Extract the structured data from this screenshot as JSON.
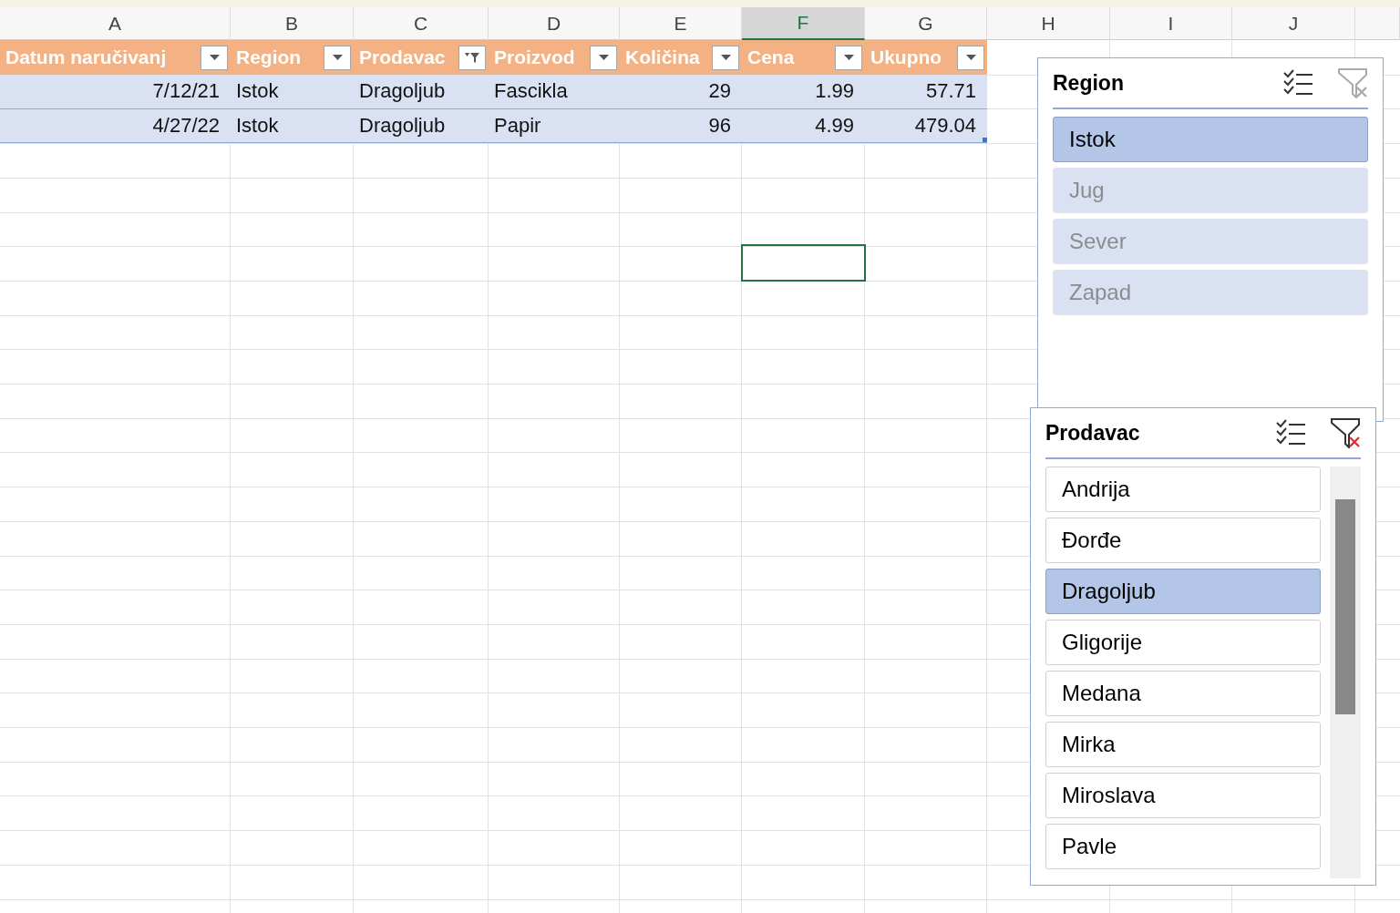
{
  "columns": [
    {
      "letter": "A",
      "selected": false
    },
    {
      "letter": "B",
      "selected": false
    },
    {
      "letter": "C",
      "selected": false
    },
    {
      "letter": "D",
      "selected": false
    },
    {
      "letter": "E",
      "selected": false
    },
    {
      "letter": "F",
      "selected": true
    },
    {
      "letter": "G",
      "selected": false
    },
    {
      "letter": "H",
      "selected": false
    },
    {
      "letter": "I",
      "selected": false
    },
    {
      "letter": "J",
      "selected": false
    }
  ],
  "table": {
    "headers": [
      {
        "label": "Datum naručivanj",
        "align_right": true,
        "filtered": false
      },
      {
        "label": "Region",
        "align_right": false,
        "filtered": false
      },
      {
        "label": "Prodavac",
        "align_right": false,
        "filtered": true
      },
      {
        "label": "Proizvod",
        "align_right": false,
        "filtered": false
      },
      {
        "label": "Količina",
        "align_right": true,
        "filtered": false
      },
      {
        "label": "Cena",
        "align_right": true,
        "filtered": false
      },
      {
        "label": "Ukupno",
        "align_right": true,
        "filtered": false
      }
    ],
    "rows": [
      [
        "7/12/21",
        "Istok",
        "Dragoljub",
        "Fascikla",
        "29",
        "1.99",
        "57.71"
      ],
      [
        "4/27/22",
        "Istok",
        "Dragoljub",
        "Papir",
        "96",
        "4.99",
        "479.04"
      ]
    ]
  },
  "slicers": [
    {
      "title": "Region",
      "clear_enabled": false,
      "scrollable": false,
      "items": [
        {
          "label": "Istok",
          "selected": true,
          "has_data": true
        },
        {
          "label": "Jug",
          "selected": false,
          "has_data": false
        },
        {
          "label": "Sever",
          "selected": false,
          "has_data": false
        },
        {
          "label": "Zapad",
          "selected": false,
          "has_data": false
        }
      ]
    },
    {
      "title": "Prodavac",
      "clear_enabled": true,
      "scrollable": true,
      "items": [
        {
          "label": "Andrija",
          "selected": false,
          "has_data": true
        },
        {
          "label": "Đorđe",
          "selected": false,
          "has_data": true
        },
        {
          "label": "Dragoljub",
          "selected": true,
          "has_data": true
        },
        {
          "label": "Gligorije",
          "selected": false,
          "has_data": true
        },
        {
          "label": "Medana",
          "selected": false,
          "has_data": true
        },
        {
          "label": "Mirka",
          "selected": false,
          "has_data": true
        },
        {
          "label": "Miroslava",
          "selected": false,
          "has_data": true
        },
        {
          "label": "Pavle",
          "selected": false,
          "has_data": true
        }
      ]
    }
  ]
}
